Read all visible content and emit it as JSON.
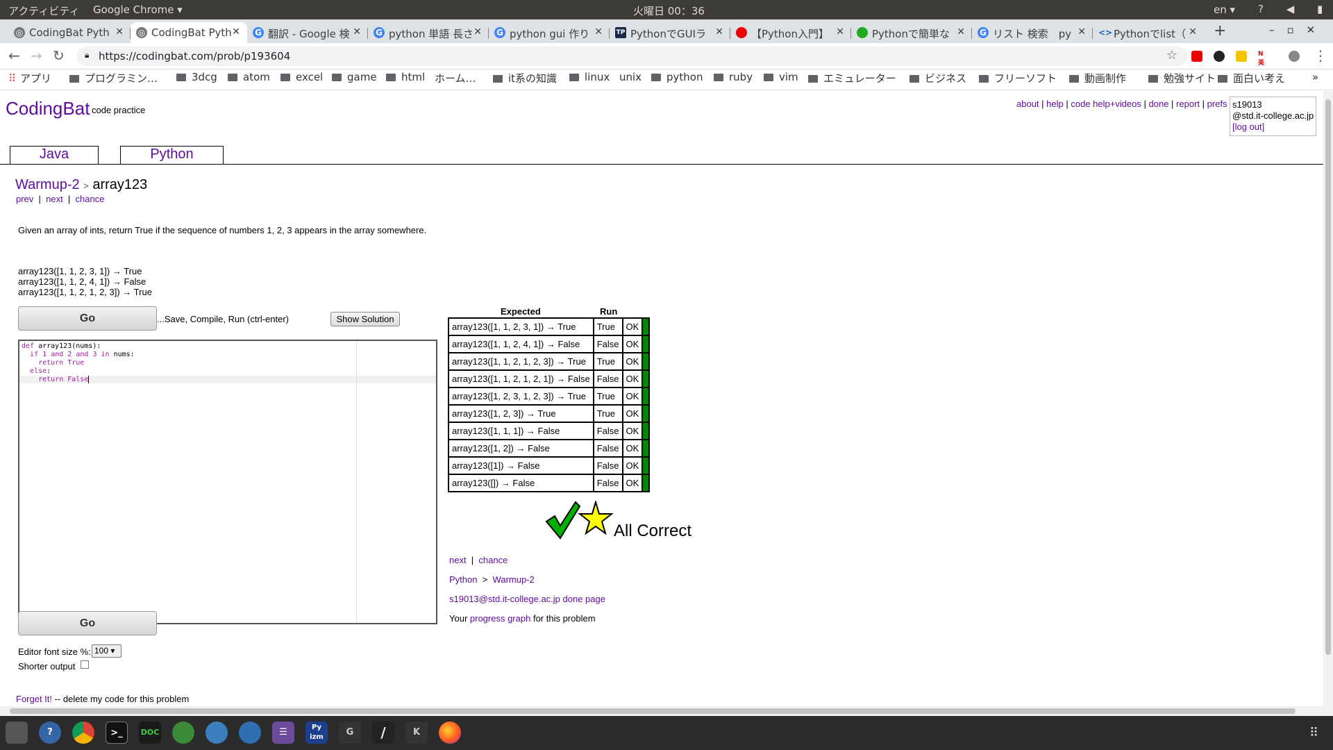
{
  "system": {
    "activities": "アクティビティ",
    "app_name": "Google Chrome ▾",
    "clock": "火曜日 00：36",
    "lang": "en ▾",
    "tray": "? ◀ ▮ ▾"
  },
  "tabs": [
    {
      "title": "CodingBat Pyth",
      "icon": "globe-icon"
    },
    {
      "title": "CodingBat Pyth",
      "icon": "globe-icon"
    },
    {
      "title": "翻訳 - Google 検",
      "icon": "google-icon"
    },
    {
      "title": "python 単語 長さ",
      "icon": "google-icon"
    },
    {
      "title": "python gui 作り",
      "icon": "google-icon"
    },
    {
      "title": "PythonでGUIラ",
      "icon": "tp-icon"
    },
    {
      "title": "【Python入門】",
      "icon": "red-dot-icon"
    },
    {
      "title": "Pythonで簡単な",
      "icon": "green-icon"
    },
    {
      "title": "リスト 検索　py",
      "icon": "google-icon"
    },
    {
      "title": "Pythonでlist（",
      "icon": "code-icon"
    }
  ],
  "url": "https://codingbat.com/prob/p193604",
  "bookmarks": [
    {
      "label": "アプリ",
      "folder": false
    },
    {
      "label": "プログラミン…",
      "folder": true
    },
    {
      "label": "3dcg",
      "folder": true
    },
    {
      "label": "atom",
      "folder": true
    },
    {
      "label": "excel",
      "folder": true
    },
    {
      "label": "game",
      "folder": true
    },
    {
      "label": "html",
      "folder": true
    },
    {
      "label": "ホーム…",
      "folder": false
    },
    {
      "label": "it系の知識",
      "folder": true
    },
    {
      "label": "linux",
      "folder": true
    },
    {
      "label": "unix",
      "folder": false
    },
    {
      "label": "python",
      "folder": true
    },
    {
      "label": "ruby",
      "folder": true
    },
    {
      "label": "vim",
      "folder": true
    },
    {
      "label": "エミュレーター",
      "folder": true
    },
    {
      "label": "ビジネス",
      "folder": true
    },
    {
      "label": "フリーソフト",
      "folder": true
    },
    {
      "label": "動画制作",
      "folder": true
    },
    {
      "label": "勉強サイト",
      "folder": true
    },
    {
      "label": "面白い考え",
      "folder": true
    }
  ],
  "site": {
    "logo": "CodingBat",
    "tagline": "code practice",
    "toplinks": [
      "about",
      "help",
      "code help+videos",
      "done",
      "report",
      "prefs"
    ],
    "user_line1": "s19013",
    "user_line2": "@std.it-college.ac.jp",
    "logout": "[log out]"
  },
  "lang_tabs": [
    "Java",
    "Python"
  ],
  "crumb": {
    "section": "Warmup-2",
    "sep": ">",
    "problem": "array123"
  },
  "nav": {
    "prev": "prev",
    "next": "next",
    "chance": "chance"
  },
  "description": "Given an array of ints, return True if the sequence of numbers 1, 2, 3 appears in the array somewhere.",
  "examples": [
    "array123([1, 1, 2, 3, 1]) → True",
    "array123([1, 1, 2, 4, 1]) → False",
    "array123([1, 1, 2, 1, 2, 3]) → True"
  ],
  "go_label": "Go",
  "save_text": "...Save, Compile, Run (ctrl-enter)",
  "solution_label": "Show Solution",
  "code": [
    "def array123(nums):",
    "  if 1 and 2 and 3 in nums:",
    "    return True",
    "  else:",
    "    return False"
  ],
  "font_size_label": "Editor font size %:",
  "font_size_value": "100 ▾",
  "shorter_label": "Shorter output",
  "forget_link": "Forget It!",
  "forget_text": " -- delete my code for this problem",
  "results": {
    "header_expected": "Expected",
    "header_run": "Run",
    "rows": [
      {
        "expected": "array123([1, 1, 2, 3, 1]) → True",
        "run": "True",
        "status": "OK"
      },
      {
        "expected": "array123([1, 1, 2, 4, 1]) → False",
        "run": "False",
        "status": "OK"
      },
      {
        "expected": "array123([1, 1, 2, 1, 2, 3]) → True",
        "run": "True",
        "status": "OK"
      },
      {
        "expected": "array123([1, 1, 2, 1, 2, 1]) → False",
        "run": "False",
        "status": "OK"
      },
      {
        "expected": "array123([1, 2, 3, 1, 2, 3]) → True",
        "run": "True",
        "status": "OK"
      },
      {
        "expected": "array123([1, 2, 3]) → True",
        "run": "True",
        "status": "OK"
      },
      {
        "expected": "array123([1, 1, 1]) → False",
        "run": "False",
        "status": "OK"
      },
      {
        "expected": "array123([1, 2]) → False",
        "run": "False",
        "status": "OK"
      },
      {
        "expected": "array123([1]) → False",
        "run": "False",
        "status": "OK"
      },
      {
        "expected": "array123([]) → False",
        "run": "False",
        "status": "OK"
      }
    ],
    "all_correct": "All Correct"
  },
  "after": {
    "next": "next",
    "chance": "chance",
    "lang": "Python",
    "arrow": ">",
    "section": "Warmup-2",
    "done_page": "s19013@std.it-college.ac.jp done page",
    "progress_prefix": "Your ",
    "progress_link": "progress graph",
    "progress_suffix": " for this problem"
  },
  "taskbar": [
    {
      "icon": "files-icon",
      "label": ""
    },
    {
      "icon": "help-icon",
      "label": "?"
    },
    {
      "icon": "chrome-icon",
      "label": ""
    },
    {
      "icon": "terminal-icon",
      "label": ">_"
    },
    {
      "icon": "doc-icon",
      "label": "DOC"
    },
    {
      "icon": "app-icon",
      "label": ""
    },
    {
      "icon": "edge-icon",
      "label": ""
    },
    {
      "icon": "edge-icon-2",
      "label": ""
    },
    {
      "icon": "text-editor-icon",
      "label": "☰"
    },
    {
      "icon": "pyizm-icon",
      "label": "Py izm"
    },
    {
      "icon": "g-icon",
      "label": "G"
    },
    {
      "icon": "slash-icon",
      "label": "/"
    },
    {
      "icon": "k-icon",
      "label": "K"
    },
    {
      "icon": "firefox-icon",
      "label": ""
    }
  ]
}
